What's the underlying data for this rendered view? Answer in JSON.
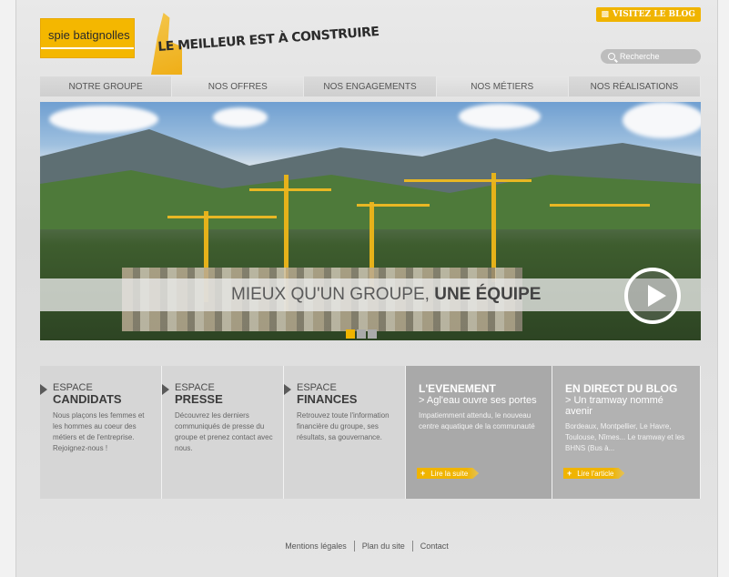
{
  "header": {
    "blog_button": "VISITEZ LE BLOG",
    "logo_text": "spie batignolles",
    "tagline": "LE MEILLEUR EST À CONSTRUIRE",
    "search_placeholder": "Recherche"
  },
  "nav": [
    {
      "label": "NOTRE GROUPE"
    },
    {
      "label": "NOS OFFRES"
    },
    {
      "label": "NOS ENGAGEMENTS"
    },
    {
      "label": "NOS MÉTIERS"
    },
    {
      "label": "NOS RÉALISATIONS"
    }
  ],
  "hero": {
    "text_light": "MIEUX QU'UN GROUPE,",
    "text_bold": "UNE ÉQUIPE"
  },
  "cards": [
    {
      "small": "ESPACE",
      "big": "CANDIDATS",
      "body": "Nous plaçons les femmes et les hommes au coeur des métiers et de l'entreprise. Rejoignez-nous !"
    },
    {
      "small": "ESPACE",
      "big": "PRESSE",
      "body": "Découvrez les derniers communiqués de presse du groupe et prenez contact avec nous."
    },
    {
      "small": "ESPACE",
      "big": "FINANCES",
      "body": "Retrouvez toute l'information financière du groupe, ses résultats, sa gouvernance."
    },
    {
      "title": "L'EVENEMENT",
      "sub": "> Agl'eau ouvre ses portes",
      "body": "Impatiemment attendu, le nouveau centre aquatique de la communauté",
      "link": "Lire la suite"
    },
    {
      "title": "EN DIRECT DU BLOG",
      "sub": "> Un tramway nommé avenir",
      "body": "Bordeaux, Montpellier, Le Havre, Toulouse, Nîmes... Le tramway et les BHNS (Bus à...",
      "link": "Lire l'article"
    }
  ],
  "footer": [
    {
      "label": "Mentions légales"
    },
    {
      "label": "Plan du site"
    },
    {
      "label": "Contact"
    }
  ],
  "colors": {
    "accent": "#f0b400",
    "nav_bg": "#d2d2d2",
    "card_dark": "#a9a9a9"
  }
}
